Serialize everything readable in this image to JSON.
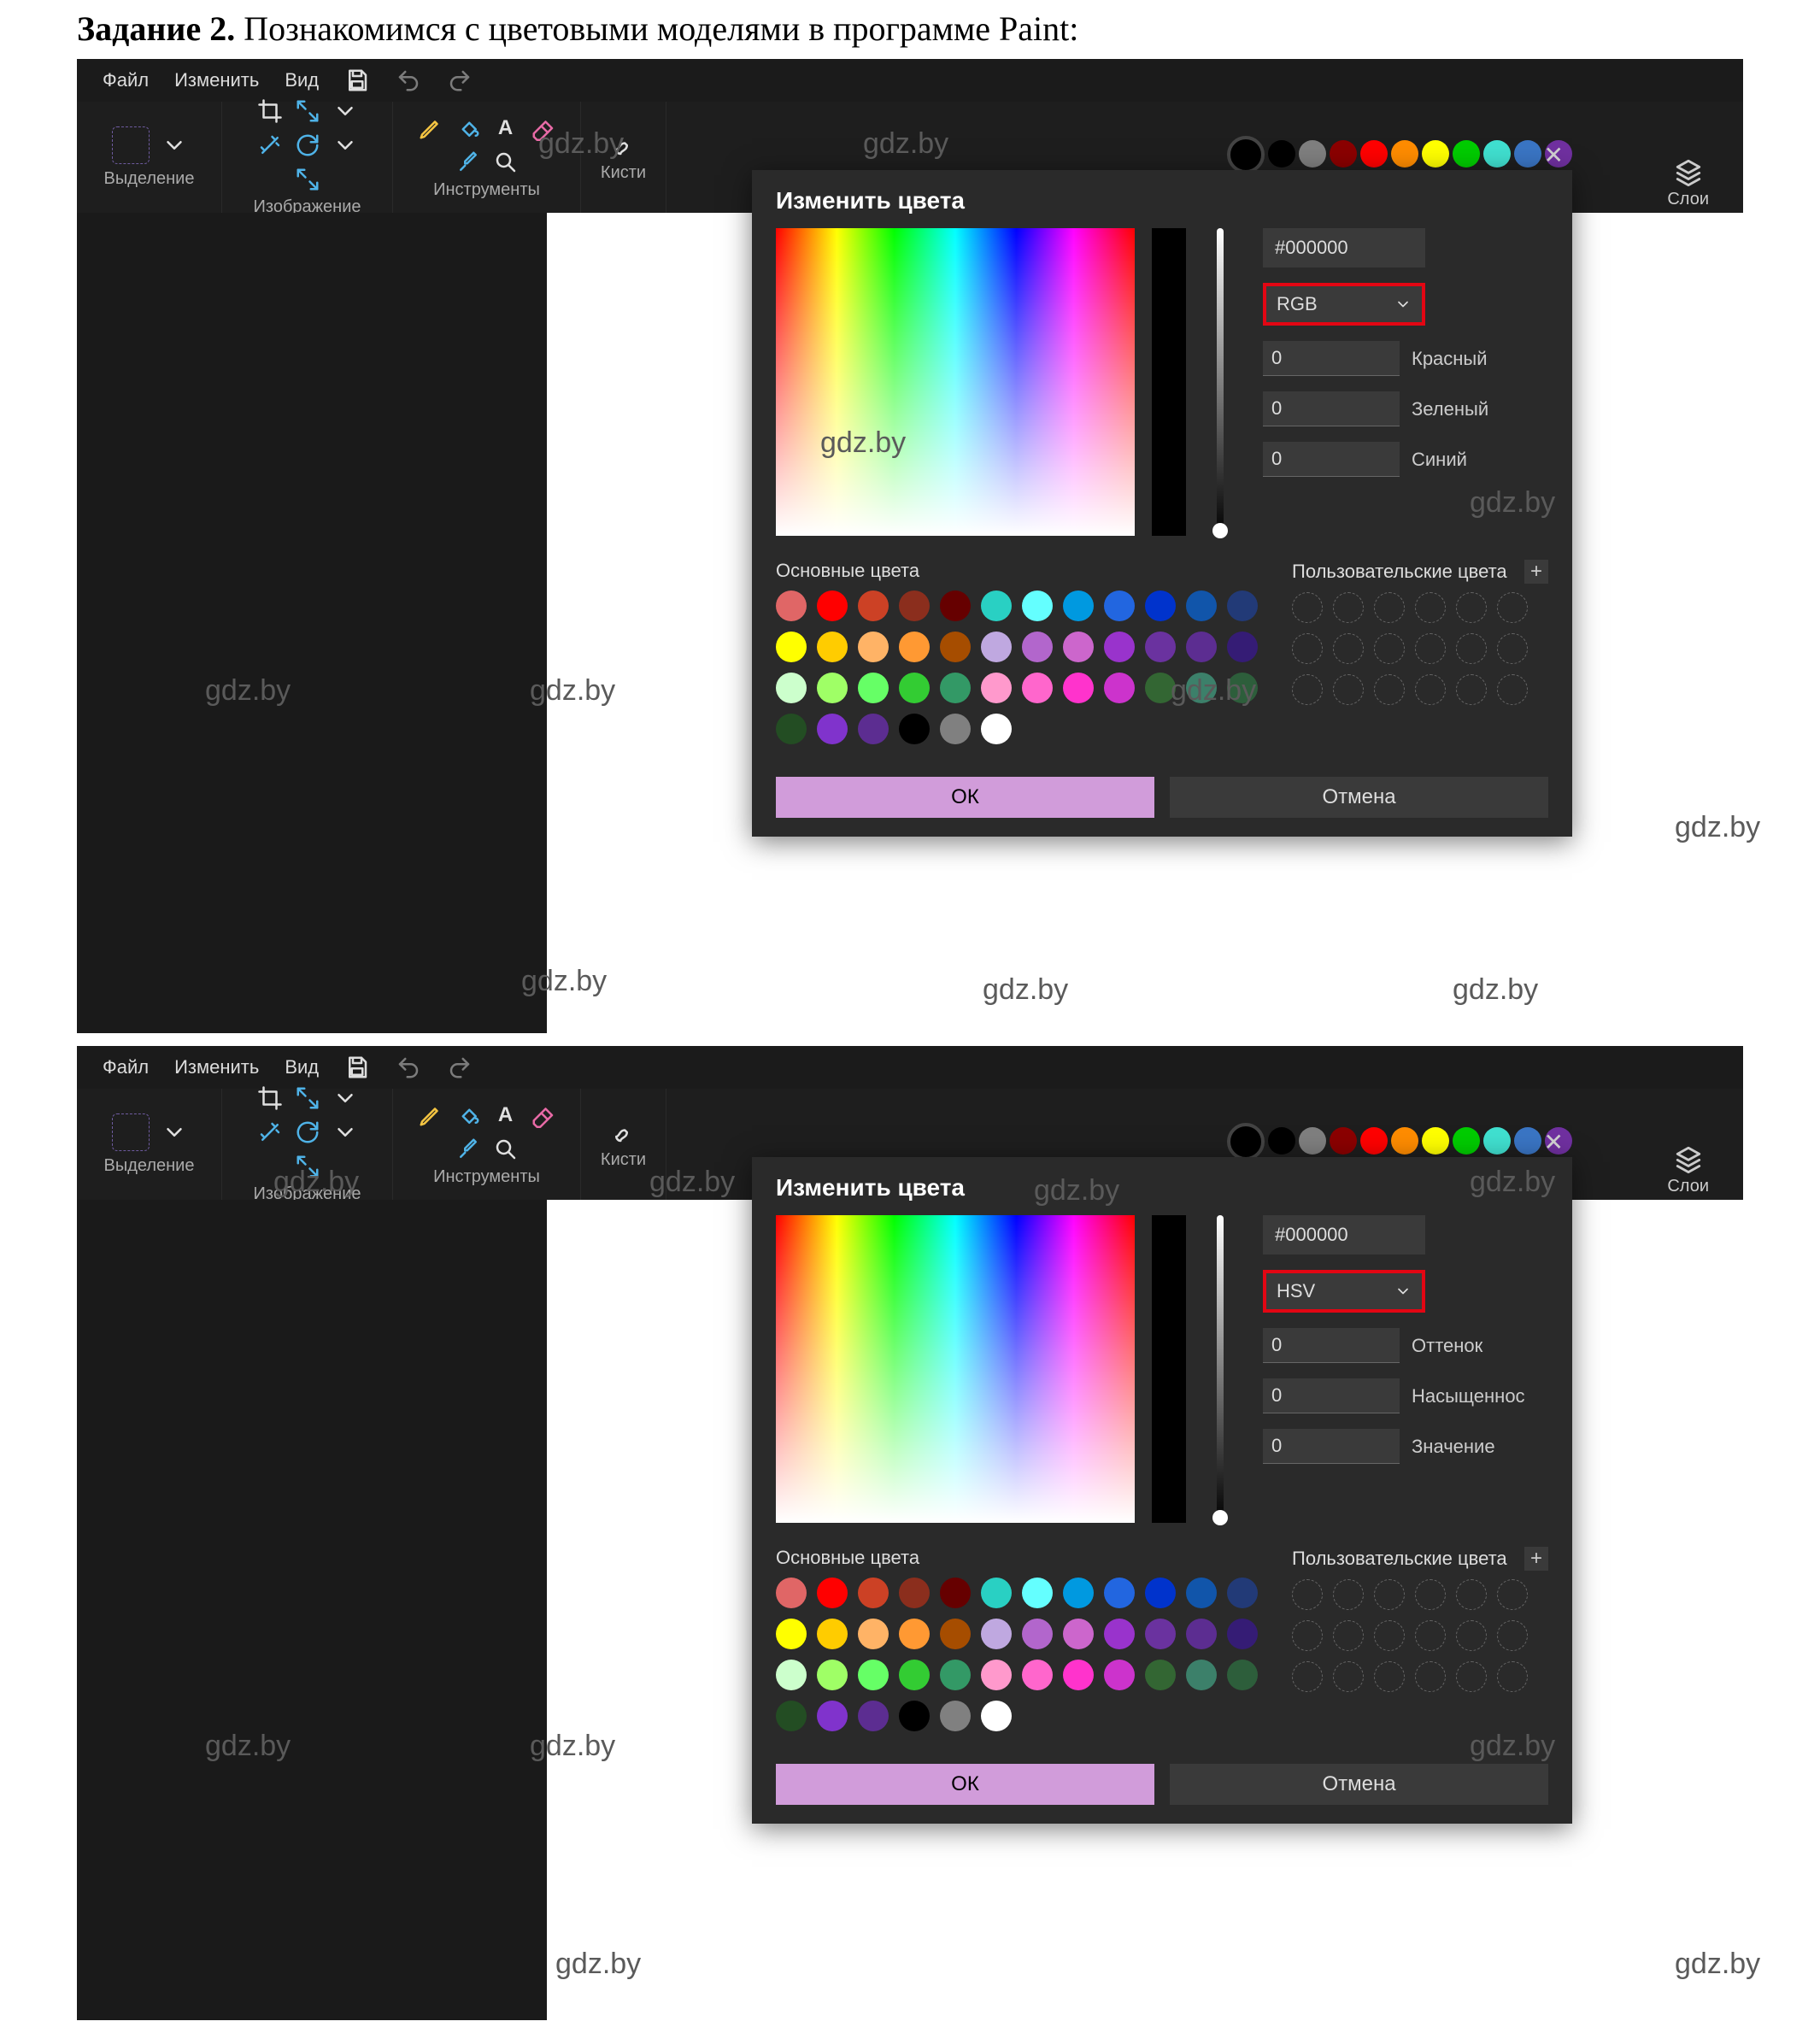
{
  "heading_bold": "Задание 2.",
  "heading_rest": " Познакомимся с цветовыми моделями в программе Paint:",
  "watermark": "gdz.by",
  "menubar": {
    "file": "Файл",
    "edit": "Изменить",
    "view": "Вид"
  },
  "ribbon": {
    "selection": "Выделение",
    "image": "Изображение",
    "tools": "Инструменты",
    "brushes": "Кисти",
    "layers": "Слои"
  },
  "swatches_top": [
    "#000000",
    "#7f7f7f",
    "#8b0000",
    "#ff0000",
    "#ff8c00",
    "#ffff00",
    "#00cc00",
    "#40e0d0",
    "#3a75c4",
    "#7030a0"
  ],
  "dialog": {
    "title": "Изменить цвета",
    "hex": "#000000",
    "ok": "ОК",
    "cancel": "Отмена",
    "basic_colors_label": "Основные цвета",
    "user_colors_label": "Пользовательские цвета",
    "palette": [
      "#e06666",
      "#ff0000",
      "#cc4125",
      "#8b2e1d",
      "#660000",
      "#29d0c3",
      "#64ffff",
      "#0099e0",
      "#2266e0",
      "#0033cc",
      "#1155aa",
      "#223a77",
      "#ffff00",
      "#ffcc00",
      "#ffb366",
      "#ff9933",
      "#a64d00",
      "#bfa8e0",
      "#b266cc",
      "#cc66cc",
      "#9933cc",
      "#6a329f",
      "#5c2d91",
      "#351c75",
      "#ccffcc",
      "#9fff66",
      "#66ff66",
      "#33cc33",
      "#339966",
      "#ff99cc",
      "#ff66cc",
      "#ff33cc",
      "#cc33cc",
      "#336633",
      "#3c806a",
      "#2d5e3b",
      "#234d23",
      "#8033cc",
      "#5c2d91",
      "#000000",
      "#808080",
      "#ffffff"
    ]
  },
  "models": {
    "rgb": {
      "name": "RGB",
      "labels": [
        "Красный",
        "Зеленый",
        "Синий"
      ],
      "values": [
        "0",
        "0",
        "0"
      ]
    },
    "hsv": {
      "name": "HSV",
      "labels": [
        "Оттенок",
        "Насыщеннос",
        "Значение"
      ],
      "values": [
        "0",
        "0",
        "0"
      ]
    }
  }
}
